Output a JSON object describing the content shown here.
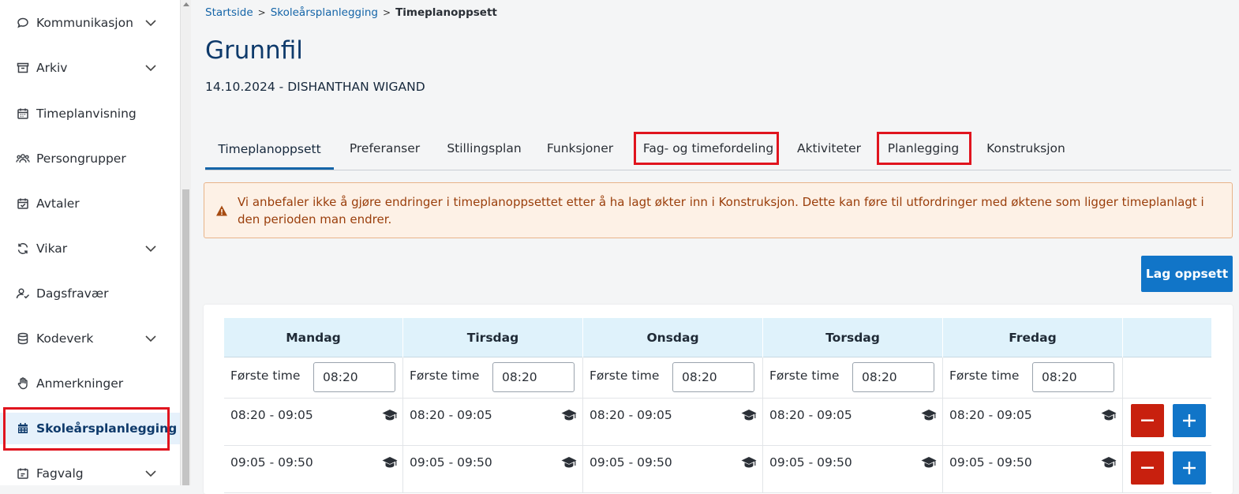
{
  "sidebar": {
    "items": [
      {
        "label": "Kommunikasjon",
        "icon": "chat-icon",
        "expandable": true
      },
      {
        "label": "Arkiv",
        "icon": "archive-icon",
        "expandable": true
      },
      {
        "label": "Timeplanvisning",
        "icon": "calendar-icon",
        "expandable": false
      },
      {
        "label": "Persongrupper",
        "icon": "people-icon",
        "expandable": false
      },
      {
        "label": "Avtaler",
        "icon": "calendar-check-icon",
        "expandable": false
      },
      {
        "label": "Vikar",
        "icon": "refresh-icon",
        "expandable": true
      },
      {
        "label": "Dagsfravær",
        "icon": "user-check-icon",
        "expandable": false
      },
      {
        "label": "Kodeverk",
        "icon": "database-icon",
        "expandable": true
      },
      {
        "label": "Anmerkninger",
        "icon": "hand-icon",
        "expandable": false
      },
      {
        "label": "Skoleårsplanlegging",
        "icon": "calendar-grid-icon",
        "expandable": false,
        "active": true
      },
      {
        "label": "Fagvalg",
        "icon": "checkbox-calendar-icon",
        "expandable": true
      }
    ]
  },
  "breadcrumb": {
    "items": [
      "Startside",
      "Skoleårsplanlegging"
    ],
    "current": "Timeplanoppsett"
  },
  "page": {
    "title": "Grunnfil",
    "subtitle": "14.10.2024 - DISHANTHAN WIGAND"
  },
  "tabs": [
    "Timeplanoppsett",
    "Preferanser",
    "Stillingsplan",
    "Funksjoner",
    "Fag- og timefordeling",
    "Aktiviteter",
    "Planlegging",
    "Konstruksjon"
  ],
  "active_tab": "Timeplanoppsett",
  "alert": {
    "text": "Vi anbefaler ikke å gjøre endringer i timeplanoppsettet etter å ha lagt økter inn i Konstruksjon. Dette kan føre til utfordringer med øktene som ligger timeplanlagt i den perioden man endrer."
  },
  "actions": {
    "create_setup_label": "Lag oppsett"
  },
  "schedule": {
    "days": [
      "Mandag",
      "Tirsdag",
      "Onsdag",
      "Torsdag",
      "Fredag"
    ],
    "first_period_label": "Første time",
    "first_period_values": [
      "08:20",
      "08:20",
      "08:20",
      "08:20",
      "08:20"
    ],
    "slots": [
      "08:20 - 09:05",
      "09:05 - 09:50"
    ],
    "slot_icon": "graduation-cap-icon",
    "remove_label": "−",
    "add_label": "+"
  },
  "colors": {
    "primary": "#1175c8",
    "danger": "#c8200e",
    "header_bg": "#dff2fb",
    "title": "#0e3a6b",
    "alert_bg": "#fdf1e6",
    "alert_text": "#9a3e0b",
    "highlight": "#e0141e"
  }
}
